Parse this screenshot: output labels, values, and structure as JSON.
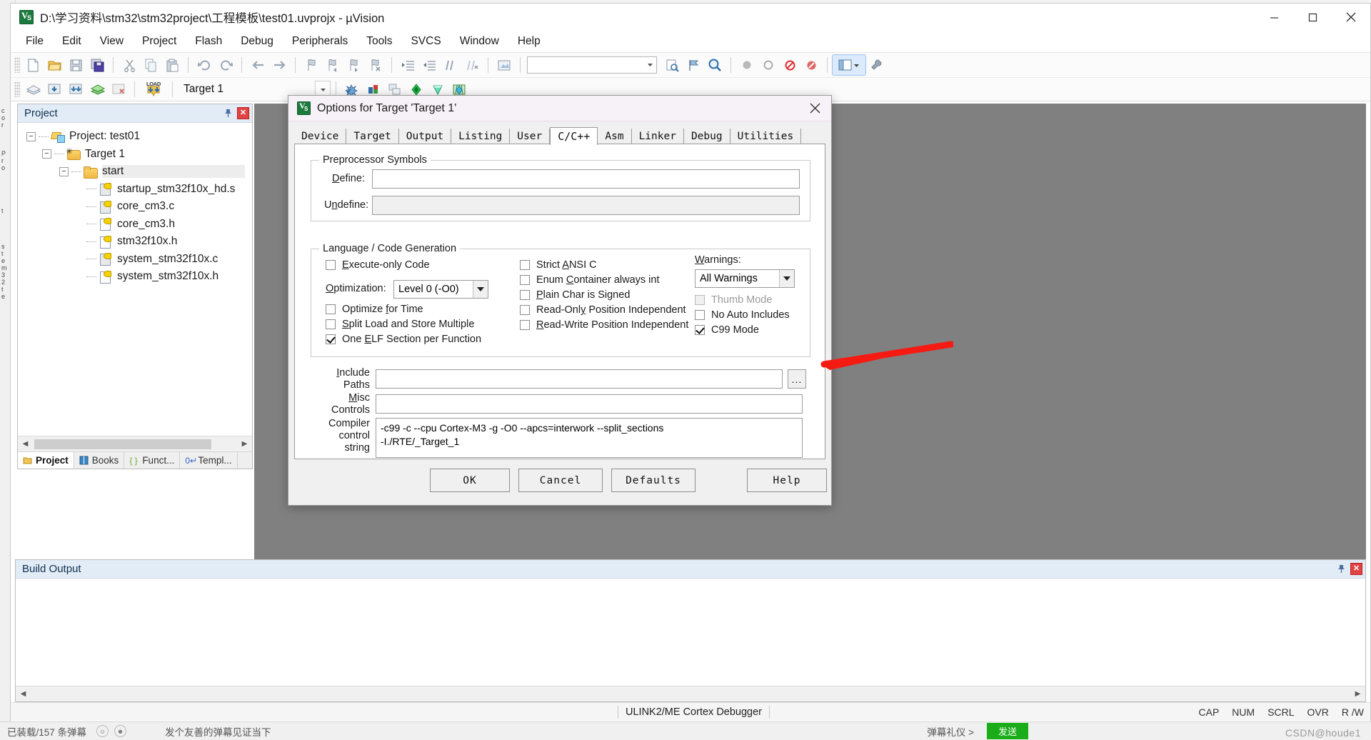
{
  "window": {
    "title": "D:\\学习资料\\stm32\\stm32project\\工程模板\\test01.uvprojx - µVision",
    "minimize": "–",
    "maximize": "□",
    "close": "✕"
  },
  "menubar": {
    "items": [
      "File",
      "Edit",
      "View",
      "Project",
      "Flash",
      "Debug",
      "Peripherals",
      "Tools",
      "SVCS",
      "Window",
      "Help"
    ]
  },
  "toolbar2": {
    "target_name": "Target 1",
    "load_label": "LOAD"
  },
  "project_panel": {
    "title": "Project",
    "tree": [
      {
        "label": "Project: test01",
        "level": 0,
        "icon": "project-icon",
        "expander": "−"
      },
      {
        "label": "Target 1",
        "level": 1,
        "icon": "target-folder-icon",
        "expander": "−"
      },
      {
        "label": "start",
        "level": 2,
        "icon": "folder-icon",
        "expander": "−",
        "selected": true
      },
      {
        "label": "startup_stm32f10x_hd.s",
        "level": 3,
        "icon": "file-key-icon",
        "expander": ""
      },
      {
        "label": "core_cm3.c",
        "level": 3,
        "icon": "file-key-icon",
        "expander": ""
      },
      {
        "label": "core_cm3.h",
        "level": 3,
        "icon": "file-key-icon",
        "expander": ""
      },
      {
        "label": "stm32f10x.h",
        "level": 3,
        "icon": "file-key-icon",
        "expander": ""
      },
      {
        "label": "system_stm32f10x.c",
        "level": 3,
        "icon": "file-key-icon",
        "expander": ""
      },
      {
        "label": "system_stm32f10x.h",
        "level": 3,
        "icon": "file-key-icon",
        "expander": ""
      }
    ],
    "tabs": [
      {
        "label": "Project",
        "active": true
      },
      {
        "label": "Books",
        "active": false
      },
      {
        "label": "Funct...",
        "active": false
      },
      {
        "label": "Templ...",
        "active": false
      }
    ]
  },
  "build_output": {
    "title": "Build Output"
  },
  "statusbar": {
    "debugger": "ULINK2/ME Cortex Debugger",
    "cap": "CAP",
    "num": "NUM",
    "scrl": "SCRL",
    "ovr": "OVR",
    "rw": "R /W"
  },
  "bottom_strip": {
    "left_text": "已装载/157 条弹幕",
    "mid_text": "发个友善的弹幕见证当下",
    "right_text": "弹幕礼仪 >",
    "send_label": "发送"
  },
  "watermark": "CSDN@houde1",
  "dialog": {
    "title": "Options for Target 'Target 1'",
    "close": "✕",
    "tabs": [
      {
        "label": "Device",
        "active": false
      },
      {
        "label": "Target",
        "active": false
      },
      {
        "label": "Output",
        "active": false
      },
      {
        "label": "Listing",
        "active": false
      },
      {
        "label": "User",
        "active": false
      },
      {
        "label": "C/C++",
        "active": true
      },
      {
        "label": "Asm",
        "active": false
      },
      {
        "label": "Linker",
        "active": false
      },
      {
        "label": "Debug",
        "active": false
      },
      {
        "label": "Utilities",
        "active": false
      }
    ],
    "preprocessor": {
      "caption": "Preprocessor Symbols",
      "define_label": "Define:",
      "define_value": "",
      "undefine_label": "Undefine:",
      "undefine_value": ""
    },
    "language": {
      "caption": "Language / Code Generation",
      "left_checks": [
        {
          "label": "Execute-only Code",
          "checked": false,
          "disabled": false
        },
        {
          "label": "Optimize for Time",
          "checked": false,
          "disabled": false
        },
        {
          "label": "Split Load and Store Multiple",
          "checked": false,
          "disabled": false
        },
        {
          "label": "One ELF Section per Function",
          "checked": true,
          "disabled": false
        }
      ],
      "optimization_label": "Optimization:",
      "optimization_value": "Level 0 (-O0)",
      "mid_checks": [
        {
          "label": "Strict ANSI C",
          "checked": false,
          "disabled": false
        },
        {
          "label": "Enum Container always int",
          "checked": false,
          "disabled": false
        },
        {
          "label": "Plain Char is Signed",
          "checked": false,
          "disabled": false
        },
        {
          "label": "Read-Only Position Independent",
          "checked": false,
          "disabled": false
        },
        {
          "label": "Read-Write Position Independent",
          "checked": false,
          "disabled": false
        }
      ],
      "warnings_label": "Warnings:",
      "warnings_value": "All Warnings",
      "right_checks": [
        {
          "label": "Thumb Mode",
          "checked": false,
          "disabled": true
        },
        {
          "label": "No Auto Includes",
          "checked": false,
          "disabled": false
        },
        {
          "label": "C99 Mode",
          "checked": true,
          "disabled": false
        }
      ]
    },
    "include_paths": {
      "label_line1": "Include",
      "label_line2": "Paths",
      "value": "",
      "browse": "..."
    },
    "misc_controls": {
      "label_line1": "Misc",
      "label_line2": "Controls",
      "value": ""
    },
    "compiler_control": {
      "label_line1": "Compiler",
      "label_line2": "control",
      "label_line3": "string",
      "line1": "-c99 -c --cpu Cortex-M3 -g -O0 --apcs=interwork --split_sections",
      "line2": "-I./RTE/_Target_1"
    },
    "buttons": [
      {
        "label": "OK"
      },
      {
        "label": "Cancel"
      },
      {
        "label": "Defaults"
      },
      {
        "label": "Help"
      }
    ]
  }
}
